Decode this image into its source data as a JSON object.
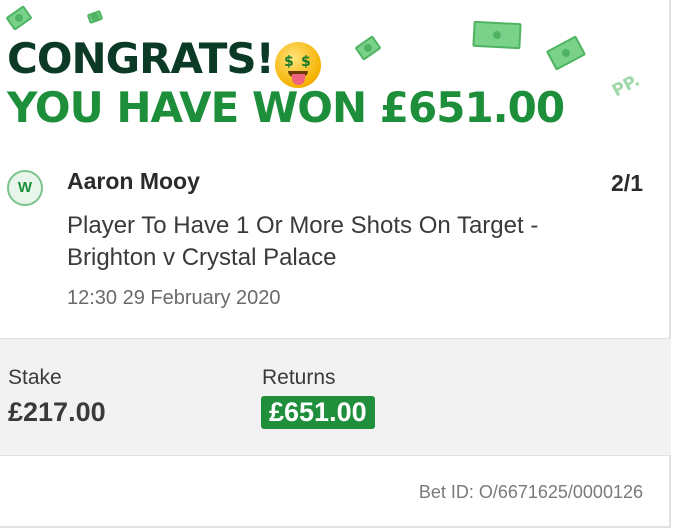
{
  "header": {
    "line1": "CONGRATS!",
    "line2": "YOU HAVE WON £651.00",
    "brand_mark": "PP.",
    "emoji": "money-mouth-face",
    "colors": {
      "dark_green": "#0b3b27",
      "green": "#1d8e3a",
      "bills": "#7ad18a"
    }
  },
  "selection": {
    "badge": "W",
    "player": "Aaron Mooy",
    "odds": "2/1",
    "market": "Player To Have 1 Or More Shots On Target - Brighton v Crystal Palace",
    "datetime": "12:30 29 February 2020"
  },
  "summary": {
    "stake_label": "Stake",
    "stake_value": "£217.00",
    "returns_label": "Returns",
    "returns_value": "£651.00",
    "returns_bg": "#1f8f3c"
  },
  "footer": {
    "bet_id": "Bet ID: O/6671625/0000126"
  }
}
